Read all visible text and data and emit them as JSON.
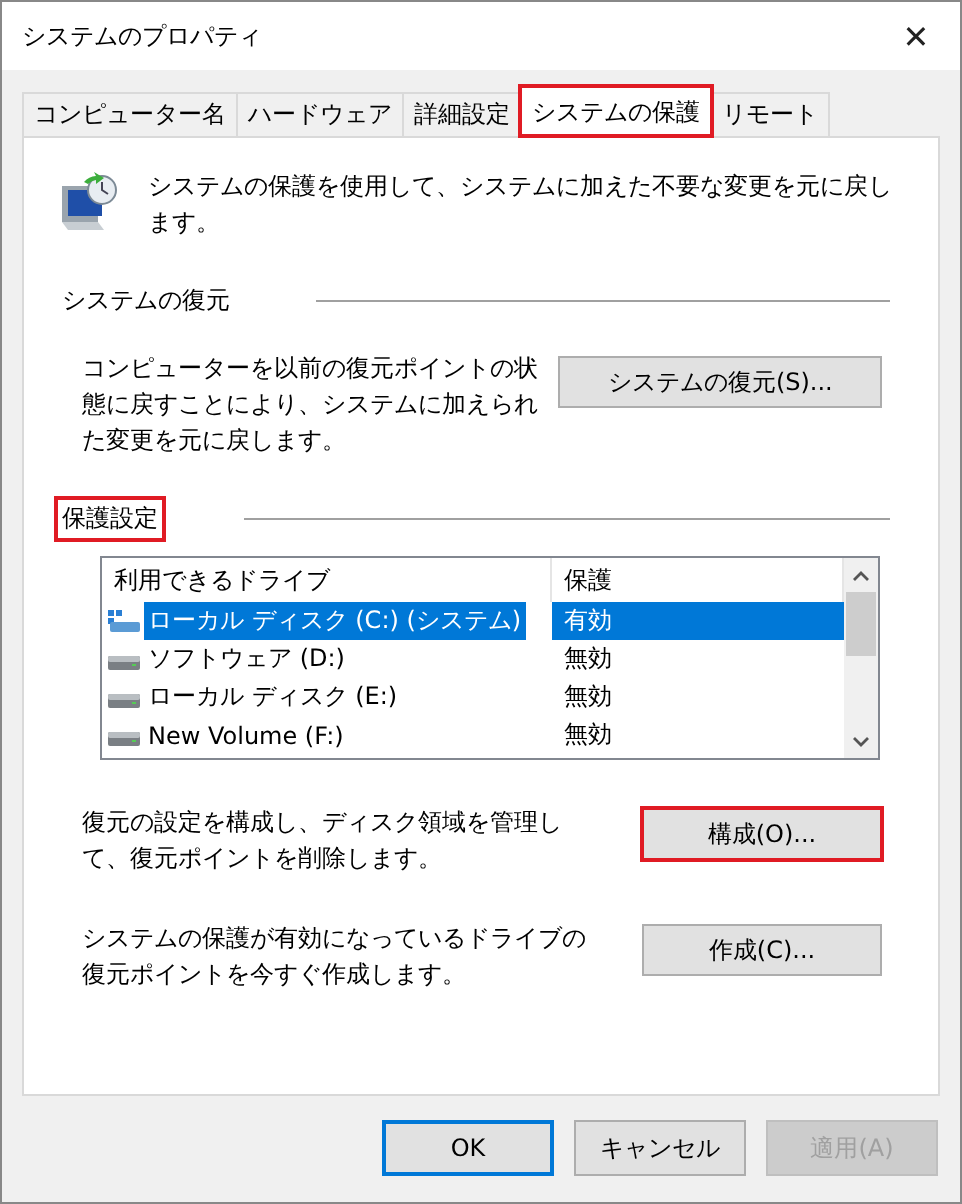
{
  "window": {
    "title": "システムのプロパティ",
    "close": "✕"
  },
  "tabs": [
    {
      "label": "コンピューター名",
      "selected": false,
      "highlighted": false
    },
    {
      "label": "ハードウェア",
      "selected": false,
      "highlighted": false
    },
    {
      "label": "詳細設定",
      "selected": false,
      "highlighted": false
    },
    {
      "label": "システムの保護",
      "selected": true,
      "highlighted": true
    },
    {
      "label": "リモート",
      "selected": false,
      "highlighted": false
    }
  ],
  "intro": "システムの保護を使用して、システムに加えた不要な変更を元に戻します。",
  "restore": {
    "heading": "システムの復元",
    "highlighted": false,
    "text": "コンピューターを以前の復元ポイントの状態に戻すことにより、システムに加えられた変更を元に戻します。",
    "button": {
      "label": "システムの復元(S)...",
      "highlighted": false
    }
  },
  "protection": {
    "heading": "保護設定",
    "highlighted": true,
    "columns": [
      "利用できるドライブ",
      "保護"
    ],
    "drives": [
      {
        "name": "ローカル ディスク (C:) (システム)",
        "protection": "有効",
        "kind": "system",
        "selected": true
      },
      {
        "name": "ソフトウェア (D:)",
        "protection": "無効",
        "kind": "disk",
        "selected": false
      },
      {
        "name": "ローカル ディスク (E:)",
        "protection": "無効",
        "kind": "disk",
        "selected": false
      },
      {
        "name": "New Volume (F:)",
        "protection": "無効",
        "kind": "disk",
        "selected": false
      }
    ],
    "actions": [
      {
        "text": "復元の設定を構成し、ディスク領域を管理して、復元ポイントを削除します。",
        "button": "構成(O)...",
        "highlighted": true
      },
      {
        "text": "システムの保護が有効になっているドライブの復元ポイントを今すぐ作成します。",
        "button": "作成(C)...",
        "highlighted": false
      }
    ]
  },
  "buttons": [
    {
      "label": "OK",
      "kind": "default",
      "disabled": false
    },
    {
      "label": "キャンセル",
      "kind": "normal",
      "disabled": false
    },
    {
      "label": "適用(A)",
      "kind": "normal",
      "disabled": true
    }
  ]
}
